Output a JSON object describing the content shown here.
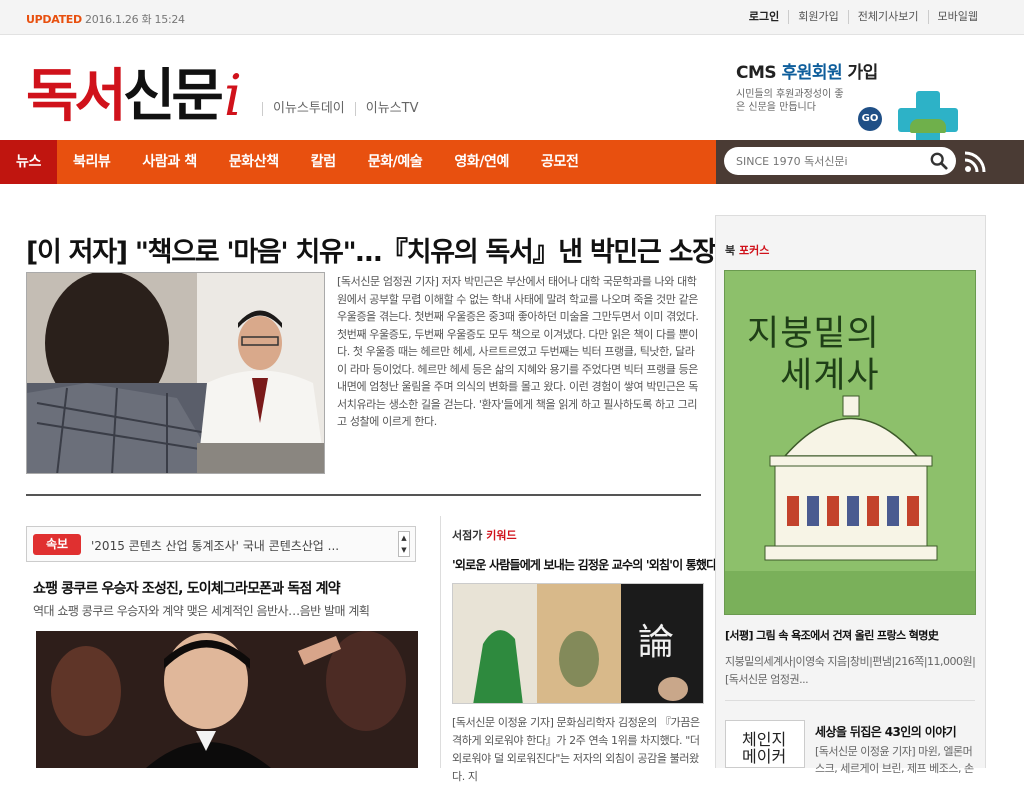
{
  "topbar": {
    "updated_label": "UPDATED",
    "updated_time": "2016.1.26 화 15:24",
    "links": [
      "로그인",
      "회원가입",
      "전체기사보기",
      "모바일웹"
    ]
  },
  "header": {
    "logo_part1": "독서",
    "logo_part2": "신문",
    "logo_i": "i",
    "sublinks": [
      "이뉴스투데이",
      "이뉴스TV"
    ],
    "cms_title_plain": "CMS ",
    "cms_title_em": "후원회원",
    "cms_title_tail": " 가입",
    "cms_desc": "시민들의 후원과정성이 좋은 신문을 만듭니다",
    "cms_go": "GO"
  },
  "nav": {
    "items": [
      "뉴스",
      "북리뷰",
      "사람과 책",
      "문화산책",
      "칼럼",
      "문화/예술",
      "영화/연예",
      "공모전"
    ],
    "active_index": 0,
    "search_placeholder": "SINCE 1970 독서신문i"
  },
  "main": {
    "headline": "[이 저자] \"책으로 '마음' 치유\"…『치유의 독서』낸 박민근 소장",
    "summary": "[독서신문 엄정권 기자] 저자 박민근은 부산에서 태어나 대학 국문학과를 나와 대학원에서 공부할 무렵 이해할 수 없는 학내 사태에 말려 학교를 나오며 죽을 것만 같은 우울증을 겪는다. 첫번째 우울증은 중3때 좋아하던 미술을 그만두면서 이미 겪었다. 첫번째 우울증도, 두번째 우울증도 모두 책으로 이겨냈다. 다만 읽은 책이 다를 뿐이다. 첫 우울증 때는 헤르만 헤세, 사르트르였고 두번째는 빅터 프랭클, 틱낫한, 달라이 라마 등이었다. 헤르만 헤세 등은 삶의 지혜와 용기를 주었다면 빅터 프랭클 등은 내면에 엄청난 울림을 주며 의식의 변화를 몰고 왔다. 이런 경험이 쌓여 박민근은 독서치유라는 생소한 길을 걷는다. '환자'들에게 책을 읽게 하고 필사하도록 하고 그리고 성찰에 이르게 한다."
  },
  "breaking": {
    "tag": "속보",
    "text": "'2015 콘텐츠 산업 통계조사' 국내 콘텐츠산업 ..."
  },
  "story2": {
    "title": "쇼팽 콩쿠르 우승자 조성진, 도이체그라모폰과 독점 계약",
    "subtitle": "역대 쇼팽 콩쿠르 우승자와 계약 맺은 세계적인 음반사…음반 발매 계획"
  },
  "keyword": {
    "head_plain": "서점가 ",
    "head_em": "키워드",
    "title": "'외로운 사람들에게 보내는 김정운 교수의 '외침'이 통했다",
    "text": "[독서신문 이정윤 기자] 문화심리학자 김정운의 『가끔은 격하게 외로워야 한다』가 2주 연속 1위를 차지했다. \"더 외로워야 덜 외로워진다\"는 저자의 외침이 공감을 불러왔다. 지"
  },
  "bookfocus": {
    "head_plain": "북 ",
    "head_em": "포커스",
    "cover_line1": "지붕밑의",
    "cover_line2": "세계사",
    "title": "[서평] 그림 속 욕조에서 건져 올린 프랑스 혁명史",
    "desc": "지붕밑의세계사|이영숙 지음|창비|편냄|216쪽|11,000원|[독서신문 엄정권...",
    "thumb_text": "체인지 메이커",
    "title2": "세상을 뒤집은 43인의 이야기",
    "desc2": "[독서신문 이정윤 기자] 마윈, 엘론머스크, 세르게이 브린, 제프 베조스, 손"
  },
  "colors": {
    "accent": "#e8500f",
    "brand_red": "#d0121b",
    "nav_active": "#c0150f",
    "nav_dark": "#4a3b34",
    "cms_blue": "#0d5d9b"
  }
}
